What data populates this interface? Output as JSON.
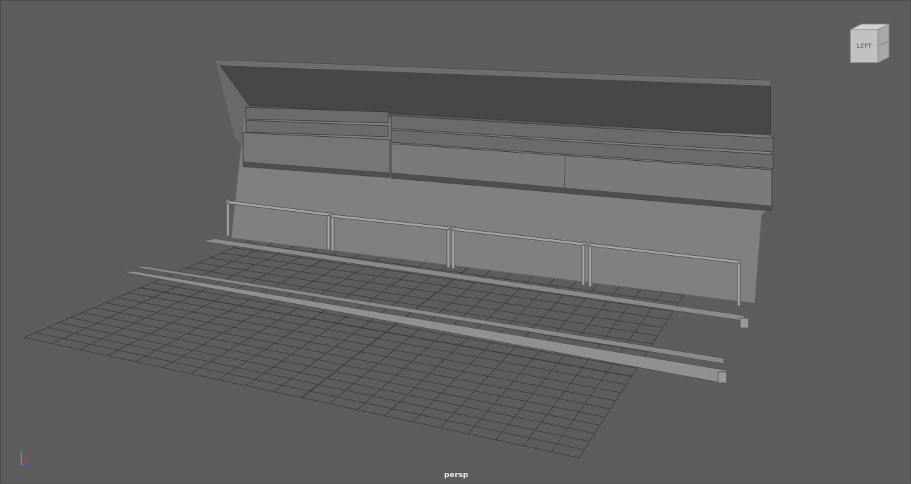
{
  "viewport": {
    "camera_label": "persp",
    "background_color": "#5d5d5d",
    "grid_color": "#3a3a3a"
  },
  "view_cube": {
    "face_label": "LEFT",
    "side_label": "FRONT"
  },
  "axis_gizmo": {
    "y_label": "y",
    "x_label": "x",
    "z_label": "z",
    "y_color": "#4fc24f",
    "x_color": "#d83a3a",
    "z_color": "#3a5fd8"
  },
  "scene_objects": {
    "wall": "tunnel-wall",
    "pipes": "pipe-bundle",
    "railing": "railing",
    "ledges": "floor-ledges",
    "ground_grid": "ground-grid"
  }
}
